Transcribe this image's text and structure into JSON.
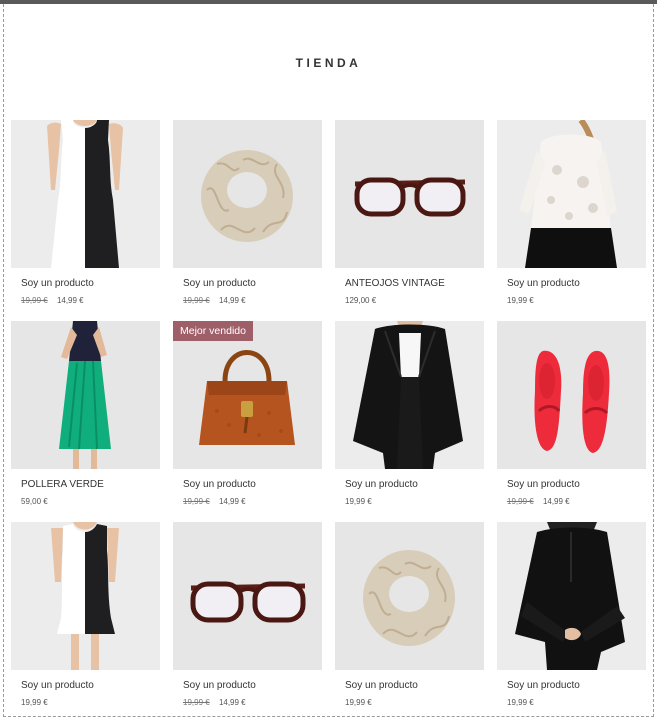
{
  "store": {
    "title": "TIENDA"
  },
  "products": [
    {
      "name": "Soy un producto",
      "old_price": "19,99 €",
      "price": "14,99 €",
      "badge": ""
    },
    {
      "name": "Soy un producto",
      "old_price": "19,99 €",
      "price": "14,99 €",
      "badge": ""
    },
    {
      "name": "ANTEOJOS VINTAGE",
      "old_price": "",
      "price": "129,00 €",
      "badge": ""
    },
    {
      "name": "Soy un producto",
      "old_price": "",
      "price": "19,99 €",
      "badge": ""
    },
    {
      "name": "POLLERA VERDE",
      "old_price": "",
      "price": "59,00 €",
      "badge": ""
    },
    {
      "name": "Soy un producto",
      "old_price": "19,99 €",
      "price": "14,99 €",
      "badge": "Mejor vendido"
    },
    {
      "name": "Soy un producto",
      "old_price": "",
      "price": "19,99 €",
      "badge": ""
    },
    {
      "name": "Soy un producto",
      "old_price": "19,99 €",
      "price": "14,99 €",
      "badge": ""
    },
    {
      "name": "Soy un producto",
      "old_price": "",
      "price": "19,99 €",
      "badge": ""
    },
    {
      "name": "Soy un producto",
      "old_price": "19,99 €",
      "price": "14,99 €",
      "badge": ""
    },
    {
      "name": "Soy un producto",
      "old_price": "",
      "price": "19,99 €",
      "badge": ""
    },
    {
      "name": "Soy un producto",
      "old_price": "",
      "price": "19,99 €",
      "badge": ""
    }
  ],
  "product_images": [
    "dress-image",
    "scarf-image",
    "glasses-image",
    "lace-blouse-image",
    "green-skirt-image",
    "handbag-image",
    "black-coat-image",
    "red-loafers-image",
    "dress-image",
    "glasses-image",
    "scarf-image",
    "black-blouse-image"
  ],
  "colors": {
    "badge": "#9e5f69",
    "tile_background": "#e6e6e6"
  }
}
